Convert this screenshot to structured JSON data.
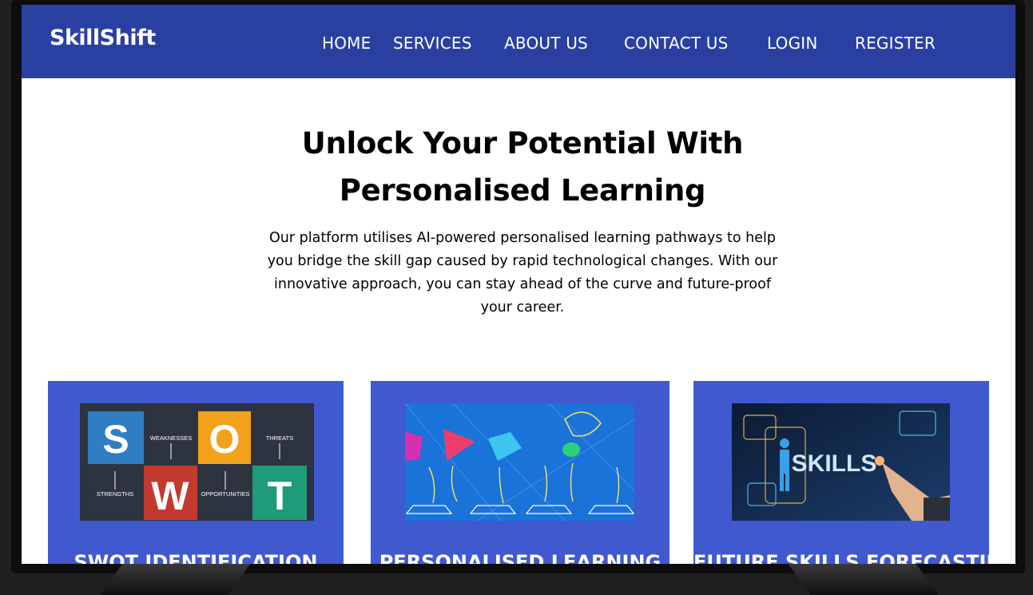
{
  "brand": "SkillShift",
  "nav": {
    "home": "HOME",
    "services": "SERVICES",
    "about": "ABOUT US",
    "contact": "CONTACT US",
    "login": "LOGIN",
    "register": "REGISTER"
  },
  "hero": {
    "title_line1": "Unlock Your Potential With",
    "title_line2": "Personalised Learning",
    "desc_line1": "Our platform utilises AI-powered personalised learning pathways to help",
    "desc_line2": "you bridge the skill gap caused by rapid technological changes. With our",
    "desc_line3": "innovative approach, you can stay ahead of the curve and future-proof",
    "desc_line4": "your career."
  },
  "cards": [
    {
      "title": "SWOT IDENTIFICATION",
      "image": {
        "letters": [
          "S",
          "W",
          "O",
          "T"
        ],
        "labels": [
          "WEAKNESSES",
          "THREATS",
          "STRENGTHS",
          "OPPORTUNITIES"
        ]
      }
    },
    {
      "title": "PERSONALISED LEARNING"
    },
    {
      "title": "FUTURE SKILLS FORECASTING",
      "image": {
        "word": "SKILLS"
      }
    }
  ],
  "colors": {
    "navbar": "#2a40a1",
    "card": "#4059cf",
    "swot_s": "#2f7ec1",
    "swot_w": "#c23a2e",
    "swot_o": "#f2a11a",
    "swot_t": "#1f9b79"
  }
}
